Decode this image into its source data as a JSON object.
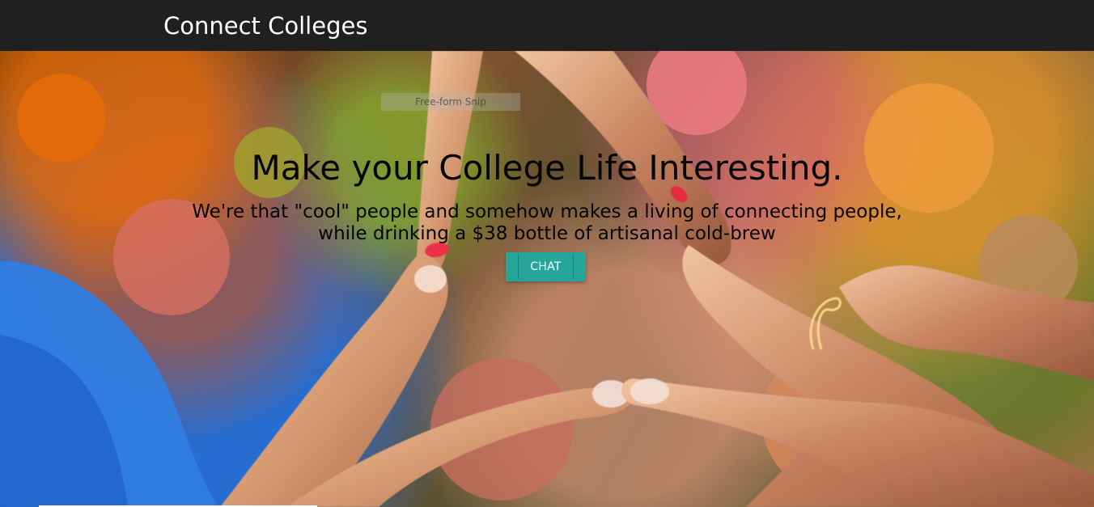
{
  "app": {
    "brand": "Connect Colleges"
  },
  "overlay": {
    "snip_label": "Free-form Snip"
  },
  "hero": {
    "title": "Make your College Life Interesting.",
    "subtitle": "We're that \"cool\" people and somehow makes a living of connecting people, while drinking a $38 bottle of artisanal cold-brew",
    "button_label": "CHAT"
  },
  "colors": {
    "navbar_background": "#202020",
    "button_background": "#26a69a",
    "text_on_dark": "#ffffff",
    "hero_text": "#050505"
  },
  "icons": {
    "background_image": "peace-sign-hands-photo"
  }
}
